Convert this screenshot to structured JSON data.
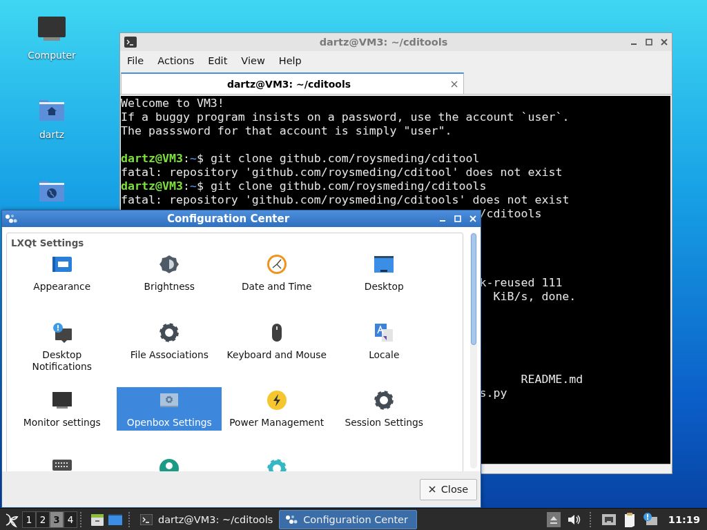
{
  "desktop": {
    "icons": [
      {
        "kind": "computer",
        "label": "Computer"
      },
      {
        "kind": "home-folder",
        "label": "dartz"
      },
      {
        "kind": "network-folder"
      }
    ]
  },
  "terminal": {
    "title": "dartz@VM3: ~/cditools",
    "menu": [
      "File",
      "Actions",
      "Edit",
      "View",
      "Help"
    ],
    "tabs": [
      {
        "label": "dartz@VM3: ~/cditools",
        "selected": true
      }
    ],
    "lines": [
      {
        "kind": "output",
        "text": "Welcome to VM3!"
      },
      {
        "kind": "output",
        "text": "If a buggy program insists on a password, use the account `user`."
      },
      {
        "kind": "output",
        "text": "The passsword for that account is simply \"user\"."
      },
      {
        "kind": "blank"
      },
      {
        "kind": "prompt",
        "user": "dartz@VM3",
        "sep": ":",
        "path": "~",
        "symbol": "$",
        "command": "git clone github.com/roysmeding/cditool"
      },
      {
        "kind": "output",
        "text": "fatal: repository 'github.com/roysmeding/cditool' does not exist"
      },
      {
        "kind": "prompt",
        "user": "dartz@VM3",
        "sep": ":",
        "path": "~",
        "symbol": "$",
        "command": "git clone github.com/roysmeding/cditools"
      },
      {
        "kind": "output",
        "text": "fatal: repository 'github.com/roysmeding/cditools' does not exist"
      },
      {
        "kind": "tail",
        "text": "/cditools"
      },
      {
        "kind": "blank"
      },
      {
        "kind": "blank"
      },
      {
        "kind": "blank"
      },
      {
        "kind": "blank"
      },
      {
        "kind": "tail",
        "text": "k-reused 111"
      },
      {
        "kind": "tail-mid",
        "text": "KiB/s, done."
      },
      {
        "kind": "blank"
      },
      {
        "kind": "blank"
      },
      {
        "kind": "blank"
      },
      {
        "kind": "blank"
      },
      {
        "kind": "blank"
      },
      {
        "kind": "tail-far",
        "text": "README.md"
      },
      {
        "kind": "tail",
        "text": "s.py"
      }
    ]
  },
  "config_center": {
    "title": "Configuration Center",
    "group": "LXQt Settings",
    "items": [
      {
        "label": "Appearance",
        "selected": false
      },
      {
        "label": "Brightness",
        "selected": false
      },
      {
        "label": "Date and Time",
        "selected": false
      },
      {
        "label": "Desktop",
        "selected": false
      },
      {
        "label": "Desktop Notifications",
        "selected": false
      },
      {
        "label": "File Associations",
        "selected": false
      },
      {
        "label": "Keyboard and Mouse",
        "selected": false
      },
      {
        "label": "Locale",
        "selected": false
      },
      {
        "label": "Monitor settings",
        "selected": false
      },
      {
        "label": "Openbox Settings",
        "selected": true
      },
      {
        "label": "Power Management",
        "selected": false
      },
      {
        "label": "Session Settings",
        "selected": false
      },
      {
        "selected": false
      },
      {
        "selected": false
      },
      {
        "selected": false
      }
    ],
    "close_button": "Close"
  },
  "taskbar": {
    "desktops": [
      {
        "label": "1",
        "selected": false
      },
      {
        "label": "2",
        "selected": false
      },
      {
        "label": "3",
        "selected": true
      },
      {
        "label": "4",
        "selected": false
      }
    ],
    "tasks": [
      {
        "kind": "terminal",
        "label": "dartz@VM3: ~/cditools",
        "selected": false
      },
      {
        "kind": "config",
        "label": "Configuration Center",
        "selected": true
      }
    ],
    "clock": "11:19"
  }
}
